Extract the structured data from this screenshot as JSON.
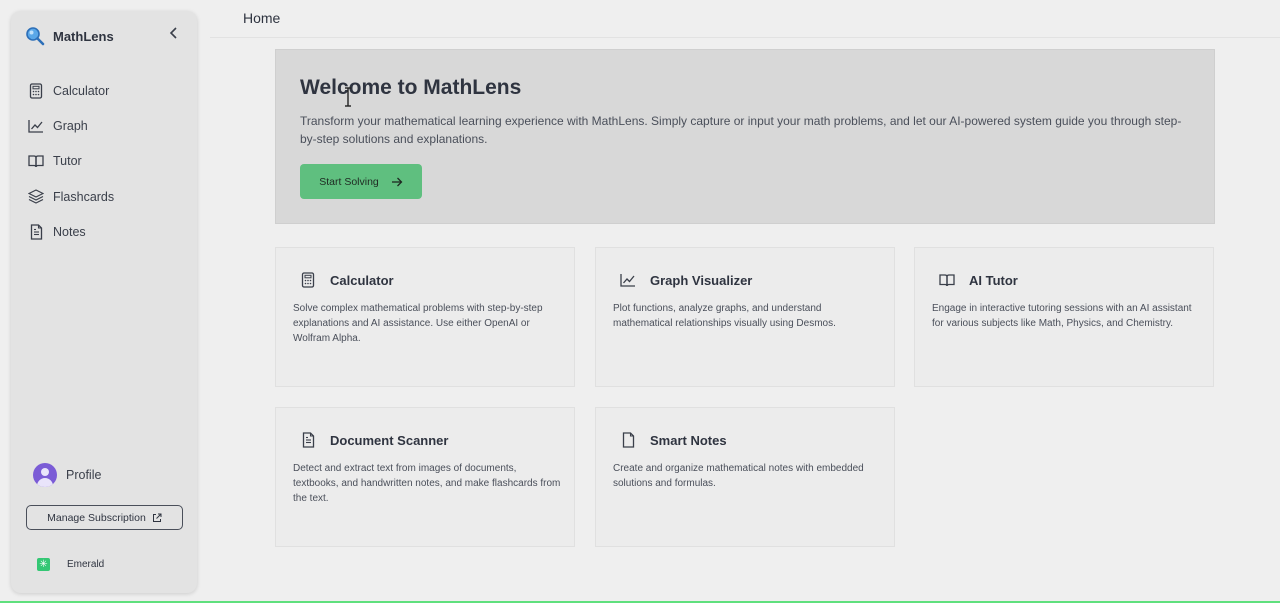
{
  "app": {
    "name": "MathLens",
    "icon": "magnifier-icon",
    "collapse_icon": "chevron-left-icon"
  },
  "sidebar": {
    "items": [
      {
        "label": "Calculator",
        "icon": "calculator-icon"
      },
      {
        "label": "Graph",
        "icon": "line-chart-icon"
      },
      {
        "label": "Tutor",
        "icon": "book-open-icon"
      },
      {
        "label": "Flashcards",
        "icon": "layers-icon"
      },
      {
        "label": "Notes",
        "icon": "file-text-icon"
      }
    ],
    "profile_label": "Profile",
    "manage_subscription_label": "Manage Subscription",
    "plan_label": "Emerald"
  },
  "topbar": {
    "title": "Home"
  },
  "hero": {
    "title": "Welcome to MathLens",
    "description": "Transform your mathematical learning experience with MathLens. Simply capture or input your math problems, and let our AI-powered system guide you through step-by-step solutions and explanations.",
    "cta_label": "Start Solving"
  },
  "cards": [
    {
      "title": "Calculator",
      "icon": "calculator-icon",
      "description": "Solve complex mathematical problems with step-by-step explanations and AI assistance. Use either OpenAI or Wolfram Alpha."
    },
    {
      "title": "Graph Visualizer",
      "icon": "line-chart-icon",
      "description": "Plot functions, analyze graphs, and understand mathematical relationships visually using Desmos."
    },
    {
      "title": "AI Tutor",
      "icon": "book-open-icon",
      "description": "Engage in interactive tutoring sessions with an AI assistant for various subjects like Math, Physics, and Chemistry."
    },
    {
      "title": "Document Scanner",
      "icon": "file-text-icon",
      "description": "Detect and extract text from images of documents, textbooks, and handwritten notes, and make flashcards from the text."
    },
    {
      "title": "Smart Notes",
      "icon": "file-icon",
      "description": "Create and organize mathematical notes with embedded solutions and formulas."
    }
  ],
  "colors": {
    "accent": "#5fbf7f",
    "plan_badge": "#34c774",
    "avatar": "#7b5cd6"
  }
}
